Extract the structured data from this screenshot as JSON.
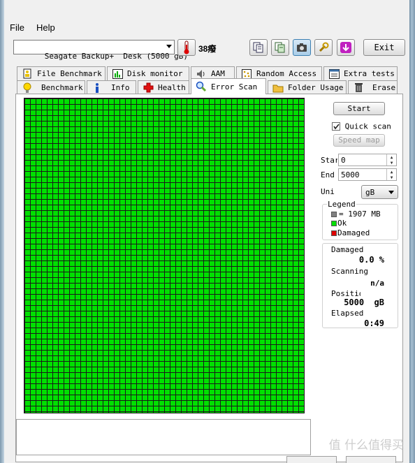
{
  "menu": {
    "file": "File",
    "help": "Help"
  },
  "toolbar": {
    "drive": "Seagate Backup+  Desk (5000 gB)",
    "temperature": "38癈",
    "exit_label": "Exit",
    "icons": [
      "copy-info-icon",
      "copy-text-icon",
      "screenshot-camera-icon",
      "options-wrench-icon",
      "save-download-icon"
    ]
  },
  "tabs_top": [
    {
      "label": "File Benchmark",
      "icon": "file-benchmark-icon"
    },
    {
      "label": "Disk monitor",
      "icon": "disk-monitor-icon"
    },
    {
      "label": "AAM",
      "icon": "aam-speaker-icon"
    },
    {
      "label": "Random Access",
      "icon": "random-access-icon"
    },
    {
      "label": "Extra tests",
      "icon": "extra-tests-icon"
    }
  ],
  "tabs_bottom": [
    {
      "label": "Benchmark",
      "icon": "lightbulb-icon"
    },
    {
      "label": "Info",
      "icon": "info-icon"
    },
    {
      "label": "Health",
      "icon": "health-cross-icon"
    },
    {
      "label": "Error Scan",
      "icon": "magnifier-icon",
      "active": true
    },
    {
      "label": "Folder Usage",
      "icon": "folder-icon"
    },
    {
      "label": "Erase",
      "icon": "trash-icon"
    }
  ],
  "scan": {
    "start_label": "Start",
    "quick_scan_label": "Quick scan",
    "quick_scan_checked": true,
    "speed_map_label": "Speed map",
    "start_field_label": "Star",
    "start_value": "0",
    "end_field_label": "End",
    "end_value": "5000",
    "unit_label": "Uni",
    "unit_value": "gB"
  },
  "legend": {
    "title": "Legend",
    "block_size": "= 1907 MB",
    "ok_label": "Ok",
    "damaged_label": "Damaged",
    "colors": {
      "block": "#808080",
      "ok": "#00e000",
      "damaged": "#e00000"
    }
  },
  "status": {
    "damaged_label": "Damaged",
    "damaged_value": "0.0 %",
    "scanning_label": "Scanning",
    "scanning_value": "n/a",
    "position_label": "Positio",
    "position_value": "5000  gB",
    "elapsed_label": "Elapsed",
    "elapsed_value": "0:49"
  },
  "scan_map": {
    "status": "all blocks ok",
    "color": "#00e000"
  },
  "watermark": "值 什么值得买"
}
